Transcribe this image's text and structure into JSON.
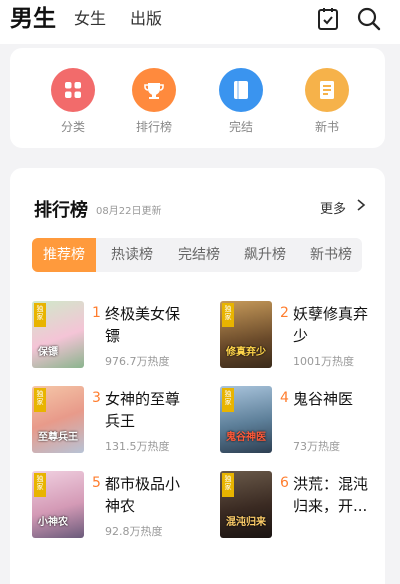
{
  "tabs": [
    "男生",
    "女生",
    "出版"
  ],
  "categories": [
    {
      "label": "分类",
      "icon": "grid-icon",
      "color": "#f26b6b"
    },
    {
      "label": "排行榜",
      "icon": "trophy-icon",
      "color": "#ff8a3d"
    },
    {
      "label": "完结",
      "icon": "book-icon",
      "color": "#3a94ef"
    },
    {
      "label": "新书",
      "icon": "new-book-icon",
      "color": "#f6b24a"
    }
  ],
  "ranking": {
    "title": "排行榜",
    "date": "08月22日更新",
    "more": "更多",
    "subtabs": [
      "推荐榜",
      "热读榜",
      "完结榜",
      "飙升榜",
      "新书榜"
    ],
    "active_subtab": "推荐榜",
    "books": [
      {
        "rank": "1",
        "name": "终极美女保镖",
        "heat": "976.7万热度",
        "badge": "独家",
        "cover_text": "保镖"
      },
      {
        "rank": "2",
        "name": "妖孽修真弃少",
        "heat": "1001万热度",
        "badge": "独家",
        "cover_text": "修真弃少"
      },
      {
        "rank": "3",
        "name": "女神的至尊兵王",
        "heat": "131.5万热度",
        "badge": "独家",
        "cover_text": "至尊兵王"
      },
      {
        "rank": "4",
        "name": "鬼谷神医",
        "heat": "73万热度",
        "badge": "独家",
        "cover_text": "鬼谷神医"
      },
      {
        "rank": "5",
        "name": "都市极品小神农",
        "heat": "92.8万热度",
        "badge": "独家",
        "cover_text": "小神农"
      },
      {
        "rank": "6",
        "name": "洪荒：混沌归来，开...",
        "heat": "",
        "badge": "独家",
        "cover_text": "混沌归来"
      }
    ]
  },
  "colors": {
    "accent": "#ff9a3c",
    "rank_number": "#ff7d2e"
  }
}
